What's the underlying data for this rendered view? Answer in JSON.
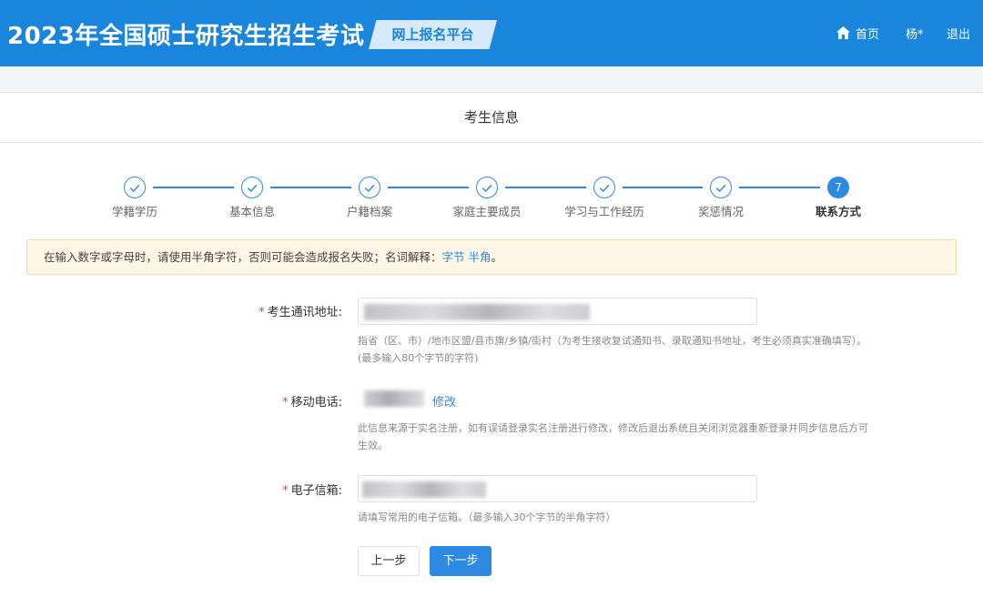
{
  "header": {
    "title": "2023年全国硕士研究生招生考试",
    "platform": "网上报名平台",
    "nav": {
      "home": "首页",
      "user": "杨*",
      "logout": "退出"
    }
  },
  "card": {
    "title": "考生信息"
  },
  "steps": [
    {
      "label": "学籍学历",
      "status": "done"
    },
    {
      "label": "基本信息",
      "status": "done"
    },
    {
      "label": "户籍档案",
      "status": "done"
    },
    {
      "label": "家庭主要成员",
      "status": "done"
    },
    {
      "label": "学习与工作经历",
      "status": "done"
    },
    {
      "label": "奖惩情况",
      "status": "done"
    },
    {
      "label": "联系方式",
      "status": "active",
      "number": "7"
    }
  ],
  "alert": {
    "text": "在输入数字或字母时，请使用半角字符，否则可能会造成报名失败；名词解释：",
    "link1": "字节",
    "link2": "半角",
    "end": "。"
  },
  "form": {
    "address": {
      "label": "考生通讯地址:",
      "hint1": "指省（区、市）/地市区盟/县市旗/乡镇/街村（为考生接收复试通知书、录取通知书地址，考生必须真实准确填写）。",
      "hint2": "(最多输入80个字节的字符)"
    },
    "phone": {
      "label": "移动电话:",
      "edit": "修改",
      "hint1": "此信息来源于实名注册，如有误请登录实名注册进行修改，修改后退出系统且关闭浏览器重新登录并同步信息后方可",
      "hint2": "生效。"
    },
    "email": {
      "label": "电子信箱:",
      "hint": "请填写常用的电子信箱。（最多输入30个字节的半角字符）"
    },
    "prev": "上一步",
    "next": "下一步"
  },
  "colors": {
    "primary": "#1a85dd",
    "accent": "#2d8ae3",
    "required": "#e0483a",
    "alert_bg": "#fdf6e7"
  }
}
